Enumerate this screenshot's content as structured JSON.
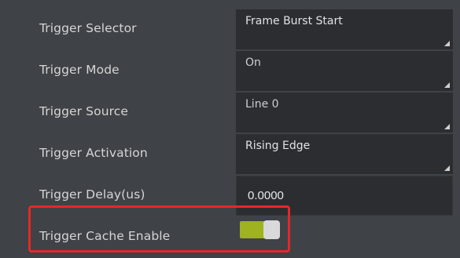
{
  "rows": [
    {
      "label": "Trigger Selector",
      "value": "Frame Burst Start"
    },
    {
      "label": "Trigger Mode",
      "value": "On"
    },
    {
      "label": "Trigger Source",
      "value": "Line 0"
    },
    {
      "label": "Trigger Activation",
      "value": "Rising Edge"
    },
    {
      "label": "Trigger Delay(us)",
      "value": "0.0000"
    },
    {
      "label": "Trigger Cache Enable",
      "value": true
    }
  ],
  "colors": {
    "toggle_on": "#9fb21f",
    "highlight": "#e5282a",
    "background": "#3f4246",
    "field": "#2b2d30"
  }
}
